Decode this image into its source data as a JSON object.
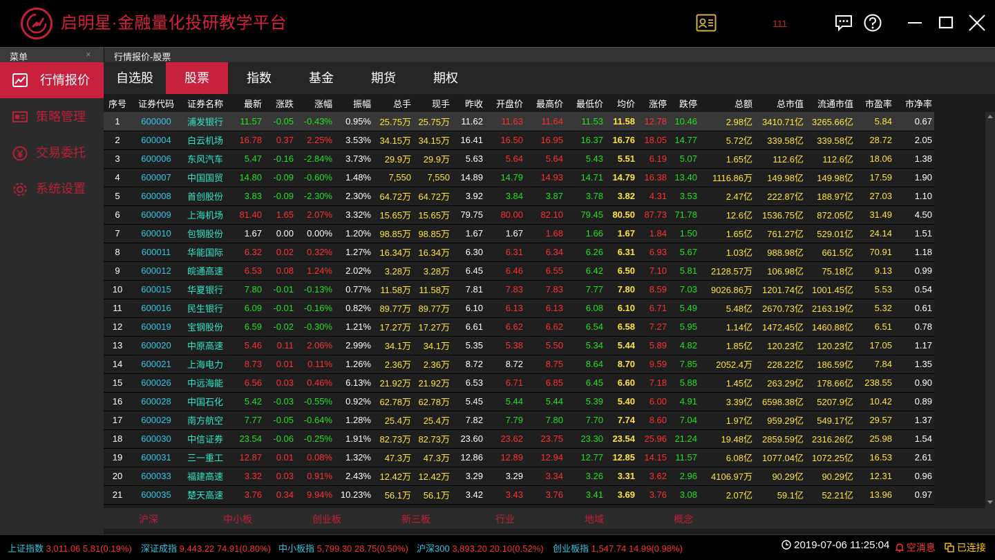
{
  "app": {
    "title": "启明星·金融量化投研教学平台",
    "user": "111"
  },
  "menu_panel": {
    "title": "菜单",
    "close": "×"
  },
  "content_panel": {
    "title": "行情报价-股票",
    "close": "×"
  },
  "sidebar": [
    {
      "label": "行情报价",
      "icon": "chart-icon"
    },
    {
      "label": "策略管理",
      "icon": "strategy-icon"
    },
    {
      "label": "交易委托",
      "icon": "yen-icon"
    },
    {
      "label": "系统设置",
      "icon": "gear-icon"
    }
  ],
  "tabs": [
    "自选股",
    "股票",
    "指数",
    "基金",
    "期货",
    "期权"
  ],
  "columns": [
    "序号",
    "证券代码",
    "证券名称",
    "最新",
    "涨跌",
    "涨幅",
    "振幅",
    "总手",
    "现手",
    "昨收",
    "开盘价",
    "最高价",
    "最低价",
    "均价",
    "涨停",
    "跌停",
    "总额",
    "总市值",
    "流通市值",
    "市盈率",
    "市净率"
  ],
  "rows": [
    [
      "1",
      "600000",
      "浦发银行",
      "11.57",
      "-0.05",
      "-0.43%",
      "0.95%",
      "25.75万",
      "25.75万",
      "11.62",
      "11.63",
      "11.64",
      "11.53",
      "11.58",
      "12.78",
      "10.46",
      "2.98亿",
      "3410.71亿",
      "3265.66亿",
      "5.84",
      "0.67"
    ],
    [
      "2",
      "600004",
      "白云机场",
      "16.78",
      "0.37",
      "2.25%",
      "3.53%",
      "34.15万",
      "34.15万",
      "16.41",
      "16.50",
      "16.95",
      "16.37",
      "16.76",
      "18.05",
      "14.77",
      "5.72亿",
      "339.58亿",
      "339.58亿",
      "28.72",
      "2.05"
    ],
    [
      "3",
      "600006",
      "东风汽车",
      "5.47",
      "-0.16",
      "-2.84%",
      "3.73%",
      "29.9万",
      "29.9万",
      "5.63",
      "5.64",
      "5.64",
      "5.43",
      "5.51",
      "6.19",
      "5.07",
      "1.65亿",
      "112.6亿",
      "112.6亿",
      "18.06",
      "1.38"
    ],
    [
      "4",
      "600007",
      "中国国贸",
      "14.80",
      "-0.09",
      "-0.60%",
      "1.48%",
      "7,550",
      "7,550",
      "14.89",
      "14.79",
      "14.93",
      "14.71",
      "14.79",
      "16.38",
      "13.40",
      "1116.86万",
      "149.98亿",
      "149.98亿",
      "17.59",
      "1.90"
    ],
    [
      "5",
      "600008",
      "首创股份",
      "3.83",
      "-0.09",
      "-2.30%",
      "2.30%",
      "64.72万",
      "64.72万",
      "3.92",
      "3.84",
      "3.87",
      "3.78",
      "3.82",
      "4.31",
      "3.53",
      "2.47亿",
      "222.87亿",
      "188.97亿",
      "27.03",
      "1.10"
    ],
    [
      "6",
      "600009",
      "上海机场",
      "81.40",
      "1.65",
      "2.07%",
      "3.32%",
      "15.65万",
      "15.65万",
      "79.75",
      "80.00",
      "82.10",
      "79.45",
      "80.50",
      "87.73",
      "71.78",
      "12.6亿",
      "1536.75亿",
      "872.05亿",
      "31.49",
      "4.50"
    ],
    [
      "7",
      "600010",
      "包钢股份",
      "1.67",
      "0.00",
      "0.00%",
      "1.20%",
      "98.85万",
      "98.85万",
      "1.67",
      "1.67",
      "1.68",
      "1.66",
      "1.67",
      "1.84",
      "1.50",
      "1.65亿",
      "761.27亿",
      "529.01亿",
      "24.14",
      "1.51"
    ],
    [
      "8",
      "600011",
      "华能国际",
      "6.32",
      "0.02",
      "0.32%",
      "1.27%",
      "16.34万",
      "16.34万",
      "6.30",
      "6.31",
      "6.34",
      "6.26",
      "6.31",
      "6.93",
      "5.67",
      "1.03亿",
      "988.98亿",
      "661.5亿",
      "70.91",
      "1.18"
    ],
    [
      "9",
      "600012",
      "皖通高速",
      "6.53",
      "0.08",
      "1.24%",
      "2.02%",
      "3.28万",
      "3.28万",
      "6.45",
      "6.46",
      "6.55",
      "6.42",
      "6.50",
      "7.10",
      "5.81",
      "2128.57万",
      "106.98亿",
      "75.18亿",
      "9.13",
      "0.99"
    ],
    [
      "10",
      "600015",
      "华夏银行",
      "7.80",
      "-0.01",
      "-0.13%",
      "0.77%",
      "11.58万",
      "11.58万",
      "7.81",
      "7.83",
      "7.83",
      "7.77",
      "7.80",
      "8.59",
      "7.03",
      "9026.86万",
      "1201.74亿",
      "1001.45亿",
      "5.53",
      "0.54"
    ],
    [
      "11",
      "600016",
      "民生银行",
      "6.09",
      "-0.01",
      "-0.16%",
      "0.82%",
      "89.77万",
      "89.77万",
      "6.10",
      "6.13",
      "6.13",
      "6.08",
      "6.10",
      "6.71",
      "5.49",
      "5.48亿",
      "2670.73亿",
      "2163.19亿",
      "5.32",
      "0.61"
    ],
    [
      "12",
      "600019",
      "宝钢股份",
      "6.59",
      "-0.02",
      "-0.30%",
      "1.21%",
      "17.27万",
      "17.27万",
      "6.61",
      "6.62",
      "6.62",
      "6.54",
      "6.58",
      "7.27",
      "5.95",
      "1.14亿",
      "1472.45亿",
      "1460.88亿",
      "6.51",
      "0.78"
    ],
    [
      "13",
      "600020",
      "中原高速",
      "5.46",
      "0.11",
      "2.06%",
      "2.99%",
      "34.1万",
      "34.1万",
      "5.35",
      "5.38",
      "5.50",
      "5.34",
      "5.44",
      "5.89",
      "4.82",
      "1.85亿",
      "120.23亿",
      "120.23亿",
      "17.05",
      "1.17"
    ],
    [
      "14",
      "600021",
      "上海电力",
      "8.73",
      "0.01",
      "0.11%",
      "1.26%",
      "2.36万",
      "2.36万",
      "8.72",
      "8.72",
      "8.75",
      "8.64",
      "8.70",
      "9.59",
      "7.85",
      "2052.4万",
      "228.22亿",
      "186.59亿",
      "7.84",
      "1.35"
    ],
    [
      "15",
      "600026",
      "中远海能",
      "6.56",
      "0.03",
      "0.46%",
      "6.13%",
      "21.92万",
      "21.92万",
      "6.53",
      "6.71",
      "6.85",
      "6.45",
      "6.60",
      "7.18",
      "5.88",
      "1.45亿",
      "263.29亿",
      "178.66亿",
      "238.55",
      "0.90"
    ],
    [
      "16",
      "600028",
      "中国石化",
      "5.42",
      "-0.03",
      "-0.55%",
      "0.92%",
      "62.78万",
      "62.78万",
      "5.45",
      "5.44",
      "5.44",
      "5.39",
      "5.40",
      "6.00",
      "4.91",
      "3.39亿",
      "6598.38亿",
      "5207.9亿",
      "10.42",
      "0.89"
    ],
    [
      "17",
      "600029",
      "南方航空",
      "7.77",
      "-0.05",
      "-0.64%",
      "1.28%",
      "25.4万",
      "25.4万",
      "7.82",
      "7.79",
      "7.80",
      "7.70",
      "7.74",
      "8.60",
      "7.04",
      "1.97亿",
      "959.29亿",
      "549.17亿",
      "29.57",
      "1.37"
    ],
    [
      "18",
      "600030",
      "中信证券",
      "23.54",
      "-0.06",
      "-0.25%",
      "1.91%",
      "82.73万",
      "82.73万",
      "23.60",
      "23.62",
      "23.75",
      "23.30",
      "23.54",
      "25.96",
      "21.24",
      "19.48亿",
      "2859.59亿",
      "2316.26亿",
      "25.98",
      "1.54"
    ],
    [
      "19",
      "600031",
      "三一重工",
      "12.87",
      "0.01",
      "0.08%",
      "1.32%",
      "47.3万",
      "47.3万",
      "12.86",
      "12.89",
      "12.94",
      "12.77",
      "12.85",
      "14.15",
      "11.57",
      "6.08亿",
      "1077.04亿",
      "1072.25亿",
      "16.53",
      "2.61"
    ],
    [
      "20",
      "600033",
      "福建高速",
      "3.32",
      "0.03",
      "0.91%",
      "2.43%",
      "12.42万",
      "12.42万",
      "3.29",
      "3.29",
      "3.34",
      "3.26",
      "3.31",
      "3.62",
      "2.96",
      "4106.97万",
      "90.29亿",
      "90.29亿",
      "12.31",
      "0.96"
    ],
    [
      "21",
      "600035",
      "楚天高速",
      "3.76",
      "0.34",
      "9.94%",
      "10.23%",
      "56.1万",
      "56.1万",
      "3.42",
      "3.43",
      "3.76",
      "3.41",
      "3.69",
      "3.76",
      "3.08",
      "2.07亿",
      "59.1亿",
      "52.21亿",
      "13.96",
      "0.97"
    ]
  ],
  "categories": [
    "沪深",
    "中小板",
    "创业板",
    "新三板",
    "行业",
    "地域",
    "概念"
  ],
  "indices": [
    {
      "name": "上证指数",
      "value": "3,011.06 5.81(0.19%)"
    },
    {
      "name": "深证成指",
      "value": "9,443.22 74.91(0.80%)"
    },
    {
      "name": "中小板指",
      "value": "5,799.30 28.75(0.50%)"
    },
    {
      "name": "沪深300",
      "value": "3,893.20 20.10(0.52%)"
    },
    {
      "name": "创业板指",
      "value": "1,547.74 14.99(0.98%)"
    }
  ],
  "status": {
    "datetime": "2019-07-06 11:25:04",
    "messages": "空消息",
    "connection": "已连接"
  },
  "colors": {
    "brand": "#c8213d",
    "up": "#ff3030",
    "down": "#22e022",
    "code": "#31c8e6",
    "name": "#2ee6c8",
    "avg": "#ffe53b"
  }
}
